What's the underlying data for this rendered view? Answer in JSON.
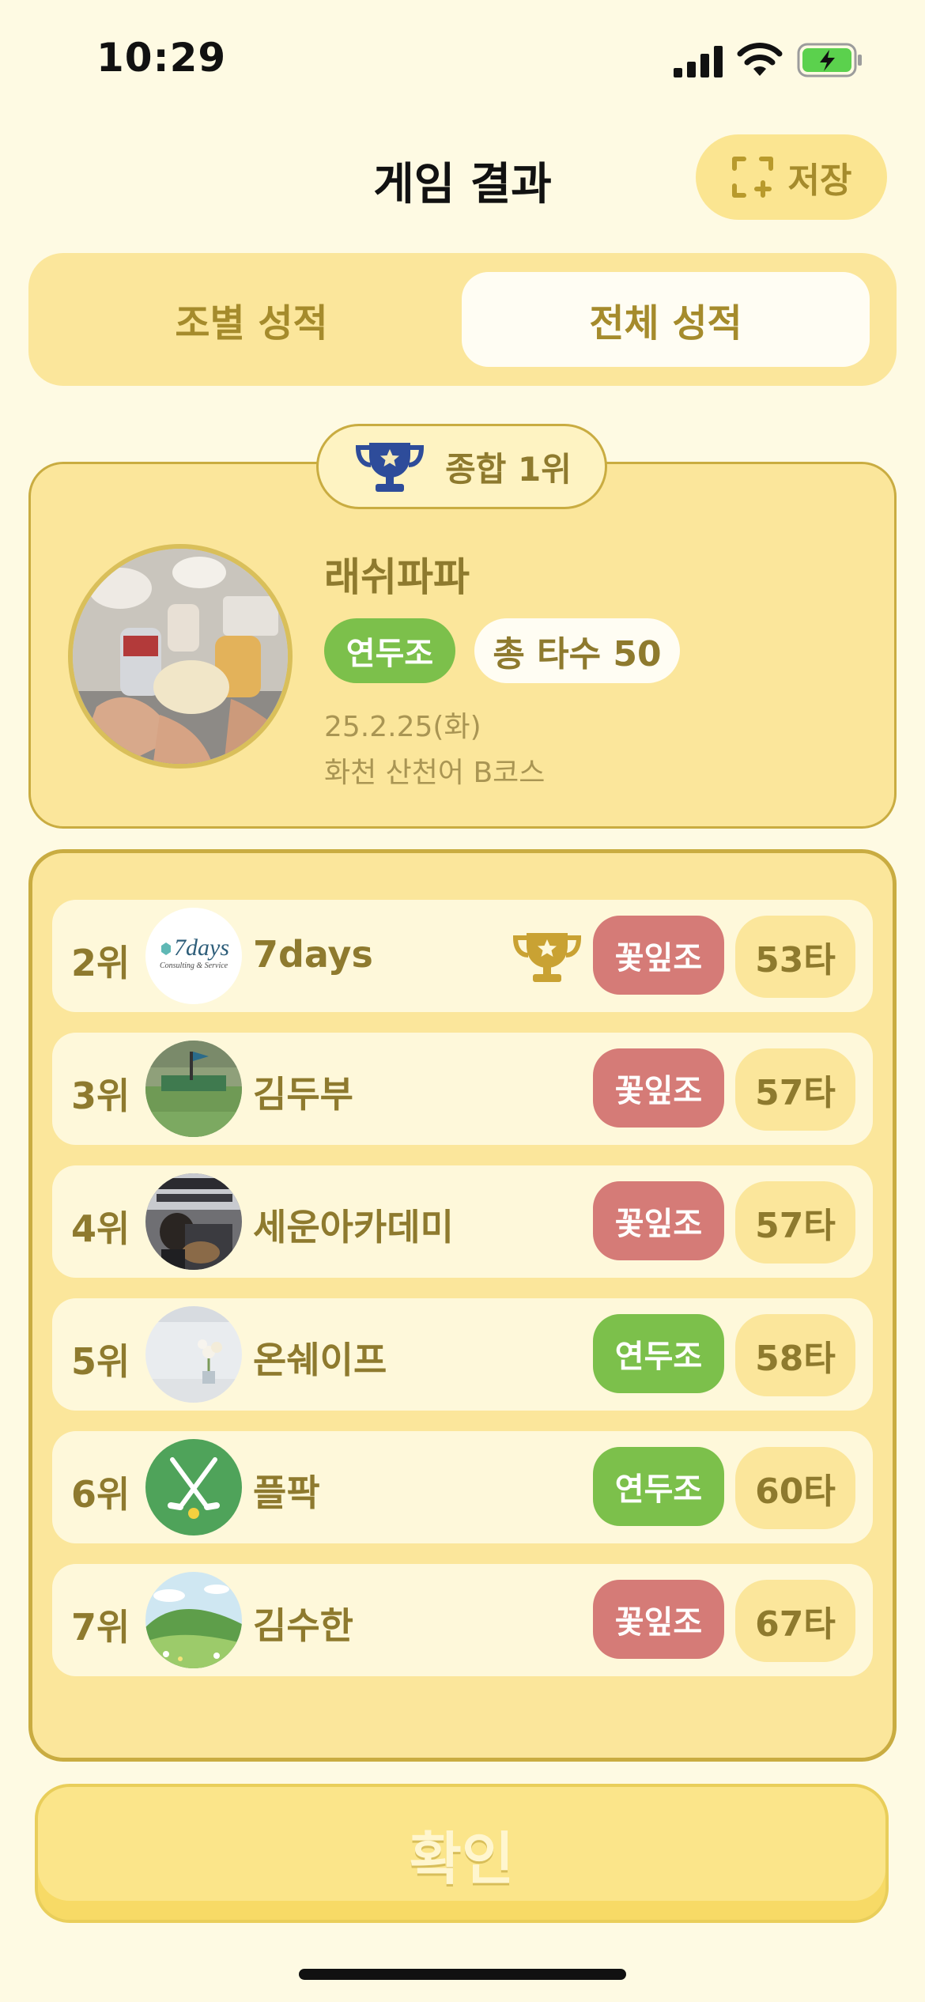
{
  "status_bar": {
    "time": "10:29"
  },
  "header": {
    "title": "게임 결과",
    "save_label": "저장"
  },
  "tabs": [
    {
      "label": "조별 성적",
      "active": false
    },
    {
      "label": "전체 성적",
      "active": true
    }
  ],
  "winner": {
    "badge": "종합 1위",
    "name": "래쉬파파",
    "team": "연두조",
    "strokes": "총 타수 50",
    "date": "25.2.25(화)",
    "course": "화천 산천어 B코스",
    "avatar_icon": "cheers-photo"
  },
  "ranking": [
    {
      "rank": "2위",
      "name": "7days",
      "team": "꽃잎조",
      "team_color": "#D57B77",
      "score": "53타",
      "trophy": true,
      "avatar_icon": "7days-logo",
      "logo_text": "7days",
      "logo_sub": "Consulting & Service"
    },
    {
      "rank": "3위",
      "name": "김두부",
      "team": "꽃잎조",
      "team_color": "#D57B77",
      "score": "57타",
      "trophy": false,
      "avatar_icon": "driving-range-photo"
    },
    {
      "rank": "4위",
      "name": "세운아카데미",
      "team": "꽃잎조",
      "team_color": "#D57B77",
      "score": "57타",
      "trophy": false,
      "avatar_icon": "blues-guitar-photo"
    },
    {
      "rank": "5위",
      "name": "온쉐이프",
      "team": "연두조",
      "team_color": "#7CC04B",
      "score": "58타",
      "trophy": false,
      "avatar_icon": "flower-room-photo"
    },
    {
      "rank": "6위",
      "name": "플팍",
      "team": "연두조",
      "team_color": "#7CC04B",
      "score": "60타",
      "trophy": false,
      "avatar_icon": "golf-clubs-icon"
    },
    {
      "rank": "7위",
      "name": "김수한",
      "team": "꽃잎조",
      "team_color": "#D57B77",
      "score": "67타",
      "trophy": false,
      "avatar_icon": "hill-landscape-photo"
    }
  ],
  "confirm_label": "확인",
  "colors": {
    "background": "#FEFAE3",
    "accent": "#FBE69B",
    "border": "#C9AC41",
    "text_gold": "#8E7A2E",
    "green": "#7CC04B",
    "pink": "#D57B77"
  }
}
